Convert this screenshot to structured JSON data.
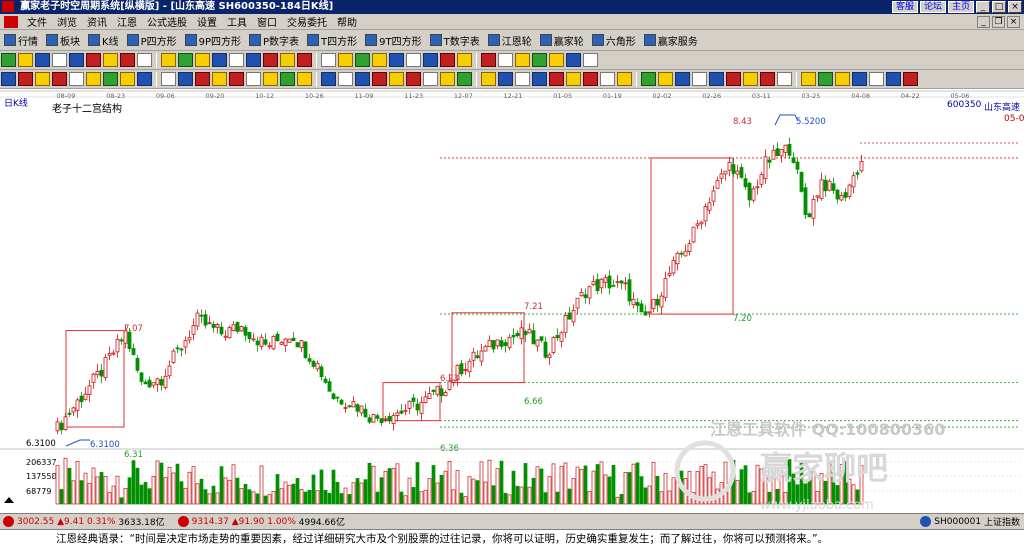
{
  "window": {
    "title": "赢家老子时空周期系统[纵横版] - [山东高速  SH600350-184日K线]",
    "links": [
      "客服",
      "论坛",
      "主页"
    ]
  },
  "menu": [
    "文件",
    "浏览",
    "资讯",
    "江恩",
    "公式选股",
    "设置",
    "工具",
    "窗口",
    "交易委托",
    "帮助"
  ],
  "toolbar1": [
    {
      "icon": "market-icon",
      "label": "行情"
    },
    {
      "icon": "sector-icon",
      "label": "板块"
    },
    {
      "icon": "kline-icon",
      "label": "K线"
    },
    {
      "icon": "p-square-icon",
      "label": "P四方形"
    },
    {
      "icon": "9p-square-icon",
      "label": "9P四方形"
    },
    {
      "icon": "p-table-icon",
      "label": "P数字表"
    },
    {
      "icon": "t-square-icon",
      "label": "T四方形"
    },
    {
      "icon": "9t-square-icon",
      "label": "9T四方形"
    },
    {
      "icon": "t-table-icon",
      "label": "T数字表"
    },
    {
      "icon": "gann-wheel-icon",
      "label": "江恩轮"
    },
    {
      "icon": "winner-wheel-icon",
      "label": "赢家轮"
    },
    {
      "icon": "hexagon-icon",
      "label": "六角形"
    },
    {
      "icon": "service-icon",
      "label": "赢家服务"
    }
  ],
  "chart": {
    "period_label": "日K线",
    "structure_label": "老子十二宫结构",
    "stock_code": "600350",
    "stock_name": "山东高速",
    "right_top_label": "05-0",
    "date_ticks": [
      "08-09",
      "08-23",
      "09-06",
      "09-20",
      "10-12",
      "10-26",
      "11-09",
      "11-23",
      "12-07",
      "12-21",
      "01-05",
      "01-19",
      "02-02",
      "02-26",
      "03-11",
      "03-25",
      "04-08",
      "04-22",
      "05-06"
    ],
    "price_labels": [
      "8.43",
      "5.5200",
      "7.07",
      "7.21",
      "7.20",
      "6.66",
      "6.31",
      "6.36",
      "6.23",
      "6.3100",
      "6.3100"
    ],
    "volume_ticks": [
      "206337",
      "137558",
      "68779"
    ],
    "watermark_tool": "江恩工具软件  QQ:100800360",
    "watermark_forum": "赢家聊吧",
    "watermark_url": "www.yjlaoba.com"
  },
  "chart_data": {
    "type": "candlestick",
    "title": "老子十二宫结构",
    "stock": "山东高速 600350",
    "x_ticks": [
      "08-09",
      "08-23",
      "09-06",
      "09-20",
      "10-12",
      "10-26",
      "11-09",
      "11-23",
      "12-07",
      "12-21",
      "01-05",
      "01-19",
      "02-02",
      "02-26",
      "03-11",
      "03-25",
      "04-08",
      "04-22",
      "05-06"
    ],
    "ylim": [
      6.2,
      8.8
    ],
    "boxes": [
      {
        "low": 6.31,
        "high": 7.07
      },
      {
        "low": 6.36,
        "high": 6.66
      },
      {
        "low": 6.66,
        "high": 7.21
      },
      {
        "low": 7.2,
        "high": 8.43
      }
    ],
    "volume_ticks": [
      206337,
      137558,
      68779
    ]
  },
  "status": {
    "index1_value": "3002.55",
    "index1_change": "▲9.41",
    "index1_pct": "0.31%",
    "index1_amount": "3633.18亿",
    "index2_value": "9314.37",
    "index2_change": "▲91.90",
    "index2_pct": "1.00%",
    "index2_amount": "4994.66亿",
    "index_code": "SH000001",
    "index_name": "上证指数"
  },
  "quote": "江恩经典语录：“时间是决定市场走势的重要因素，经过详细研究大市及个别股票的过往记录，你将可以证明，历史确实重复发生；而了解过往，你将可以预测将来。”。",
  "colors": {
    "up": "#d01010",
    "down": "#009000",
    "grid": "#b0b0b0",
    "box": "#e03030",
    "axis_text": "#606060"
  }
}
